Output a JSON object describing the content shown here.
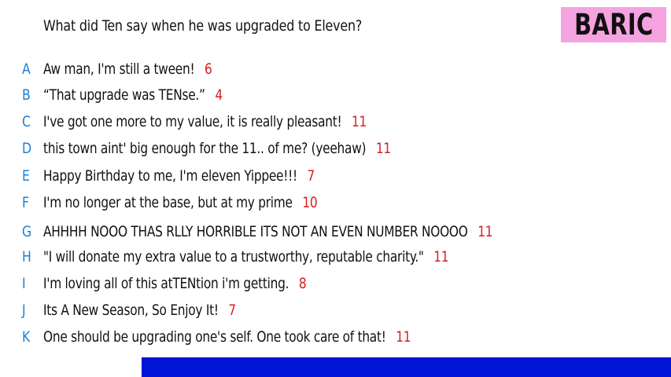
{
  "question": "What did Ten say when he was upgraded to Eleven?",
  "badge": "BARIC",
  "colors": {
    "badge_bg": "#f5a3e0",
    "letter": "#1a7fd6",
    "score": "#d42020",
    "bottom_bar": "#0015d8"
  },
  "answers": [
    {
      "letter": "A",
      "text": "Aw man, I'm still a tween!",
      "score": "6"
    },
    {
      "letter": "B",
      "text": "“That upgrade was TENse.”",
      "score": "4"
    },
    {
      "letter": "C",
      "text": "I've got one more to my value, it is really pleasant!",
      "score": "11"
    },
    {
      "letter": "D",
      "text": "this town aint' big enough for the 11.. of me? (yeehaw)",
      "score": "11"
    },
    {
      "letter": "E",
      "text": "Happy Birthday to me, I'm eleven Yippee!!!",
      "score": "7"
    },
    {
      "letter": "F",
      "text": "I'm no longer at the base, but at my prime",
      "score": "10"
    },
    {
      "letter": "G",
      "text": "AHHHH NOOO THAS RLLY HORRIBLE ITS NOT AN EVEN NUMBER NOOOO",
      "score": "11"
    },
    {
      "letter": "H",
      "text": "\"I will donate my extra value to a trustworthy, reputable charity.\"",
      "score": "11"
    },
    {
      "letter": "I",
      "text": "I'm loving all of this atTENtion i'm getting.",
      "score": "8"
    },
    {
      "letter": "J",
      "text": "Its A New Season, So Enjoy It!",
      "score": "7"
    },
    {
      "letter": "K",
      "text": "One should be upgrading one's self. One took care of that!",
      "score": "11"
    }
  ]
}
